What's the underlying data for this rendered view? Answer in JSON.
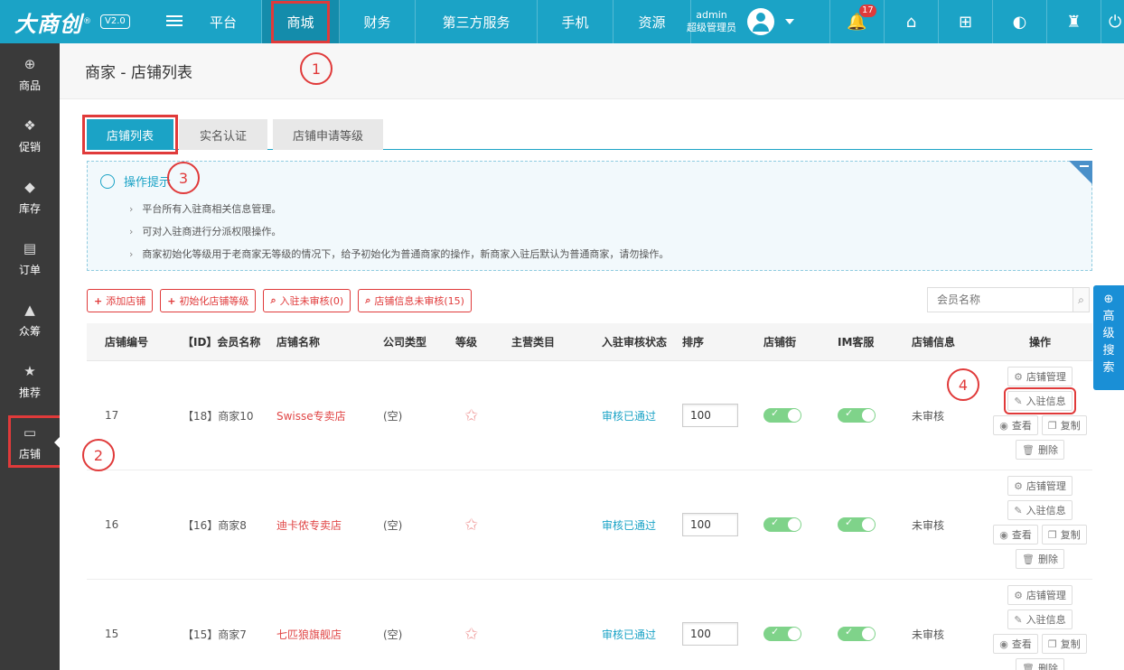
{
  "app": {
    "logo": "大商创",
    "version": "V2.0"
  },
  "nav": [
    {
      "label": "平台",
      "active": false
    },
    {
      "label": "商城",
      "active": true
    },
    {
      "label": "财务",
      "active": false
    },
    {
      "label": "第三方服务",
      "active": false
    },
    {
      "label": "手机",
      "active": false
    },
    {
      "label": "资源",
      "active": false
    }
  ],
  "user": {
    "name": "admin",
    "role": "超级管理员"
  },
  "notifications": {
    "count": "17"
  },
  "sidebar": [
    {
      "label": "商品",
      "icon": "basket-icon"
    },
    {
      "label": "促销",
      "icon": "promo-icon"
    },
    {
      "label": "库存",
      "icon": "tag-icon"
    },
    {
      "label": "订单",
      "icon": "clipboard-icon"
    },
    {
      "label": "众筹",
      "icon": "crowdfund-icon"
    },
    {
      "label": "推荐",
      "icon": "star-icon"
    },
    {
      "label": "店铺",
      "icon": "store-icon",
      "active": true
    }
  ],
  "page": {
    "title": "商家 - 店铺列表"
  },
  "tabs": [
    {
      "label": "店铺列表",
      "active": true
    },
    {
      "label": "实名认证",
      "active": false
    },
    {
      "label": "店铺申请等级",
      "active": false
    }
  ],
  "tips": {
    "title": "操作提示",
    "items": [
      "平台所有入驻商相关信息管理。",
      "可对入驻商进行分派权限操作。",
      "商家初始化等级用于老商家无等级的情况下，给予初始化为普通商家的操作，新商家入驻后默认为普通商家，请勿操作。"
    ]
  },
  "toolbar": {
    "add_store": "添加店铺",
    "init_level": "初始化店铺等级",
    "unreviewed": "入驻未审核(0)",
    "info_unreviewed": "店铺信息未审核(15)"
  },
  "search": {
    "placeholder": "会员名称",
    "advanced": "高级搜索"
  },
  "table": {
    "headers": [
      "店铺编号",
      "【ID】会员名称",
      "店铺名称",
      "公司类型",
      "等级",
      "主营类目",
      "入驻审核状态",
      "排序",
      "店铺街",
      "IM客服",
      "店铺信息",
      "操作"
    ],
    "rows": [
      {
        "id": "17",
        "member": "【18】商家10",
        "store": "Swisse专卖店",
        "company": "(空)",
        "category": "",
        "audit": "审核已通过",
        "sort": "100",
        "info": "未审核"
      },
      {
        "id": "16",
        "member": "【16】商家8",
        "store": "迪卡侬专卖店",
        "company": "(空)",
        "category": "",
        "audit": "审核已通过",
        "sort": "100",
        "info": "未审核"
      },
      {
        "id": "15",
        "member": "【15】商家7",
        "store": "七匹狼旗舰店",
        "company": "(空)",
        "category": "",
        "audit": "审核已通过",
        "sort": "100",
        "info": "未审核"
      }
    ],
    "actions": {
      "manage": "店铺管理",
      "join_info": "入驻信息",
      "view": "查看",
      "copy": "复制",
      "delete": "删除"
    }
  },
  "annotations": [
    "1",
    "2",
    "3",
    "4"
  ],
  "colors": {
    "primary": "#1ba3c6",
    "accent_red": "#e03a3a",
    "sidebar": "#3a3a3a"
  }
}
